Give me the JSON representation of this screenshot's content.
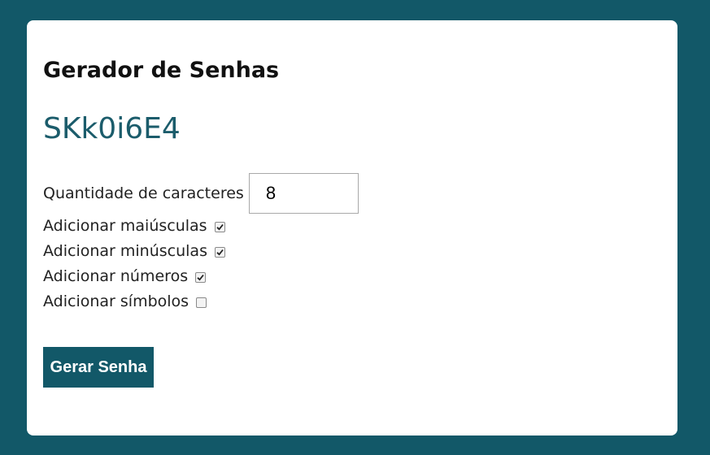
{
  "app": {
    "title": "Gerador de Senhas",
    "generated_password": "SKk0i6E4"
  },
  "colors": {
    "background": "#125868",
    "accent": "#125868",
    "password_text": "#1b5c6b"
  },
  "options": {
    "length": {
      "label": "Quantidade de caracteres",
      "value": "8"
    },
    "uppercase": {
      "label": "Adicionar maiúsculas",
      "checked": true
    },
    "lowercase": {
      "label": "Adicionar minúsculas",
      "checked": true
    },
    "numbers": {
      "label": "Adicionar números",
      "checked": true
    },
    "symbols": {
      "label": "Adicionar símbolos",
      "checked": false
    }
  },
  "actions": {
    "generate_label": "Gerar Senha"
  }
}
